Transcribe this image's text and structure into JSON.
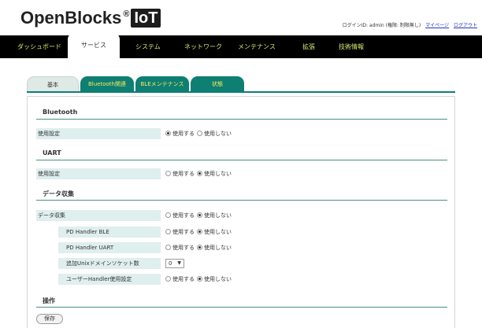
{
  "header": {
    "logo_text": "OpenBlocks",
    "logo_reg": "®",
    "logo_badge": "IoT",
    "login_label": "ログインID: admin (権限: 制限無し)",
    "mypage_link": "マイページ",
    "logout_link": "ログアウト"
  },
  "mainnav": {
    "items": [
      {
        "label": "ダッシュボード"
      },
      {
        "label": "サービス"
      },
      {
        "label": "システム"
      },
      {
        "label": "ネットワーク"
      },
      {
        "label": "メンテナンス"
      },
      {
        "label": "拡張"
      },
      {
        "label": "技術情報"
      }
    ],
    "active": "サービス"
  },
  "subtabs": {
    "items": [
      {
        "label": "基本"
      },
      {
        "label": "Bluetooth関連"
      },
      {
        "label": "BLEメンテナンス"
      },
      {
        "label": "状態"
      }
    ],
    "active": "基本"
  },
  "radio": {
    "use": "使用する",
    "nouse": "使用しない"
  },
  "sections": {
    "bluetooth": {
      "title": "Bluetooth",
      "rows": [
        {
          "label": "使用設定",
          "value": "使用する"
        }
      ]
    },
    "uart": {
      "title": "UART",
      "rows": [
        {
          "label": "使用設定",
          "value": "使用しない"
        }
      ]
    },
    "datacollect": {
      "title": "データ収集",
      "rows": [
        {
          "label": "データ収集",
          "value": "使用しない"
        },
        {
          "label": "PD Handler BLE",
          "value": "使用しない"
        },
        {
          "label": "PD Handler UART",
          "value": "使用しない"
        },
        {
          "label": "追加Unixドメインソケット数",
          "select_value": "0"
        },
        {
          "label": "ユーザーHandler使用設定",
          "value": "使用しない"
        }
      ]
    },
    "ops": {
      "title": "操作",
      "save_label": "保存"
    }
  },
  "colors": {
    "nav_bg": "#000000",
    "nav_text": "#d9e86a",
    "tab_teal": "#0d7f73",
    "tab_text": "#ffe85a",
    "label_bg": "#dfeeee"
  }
}
